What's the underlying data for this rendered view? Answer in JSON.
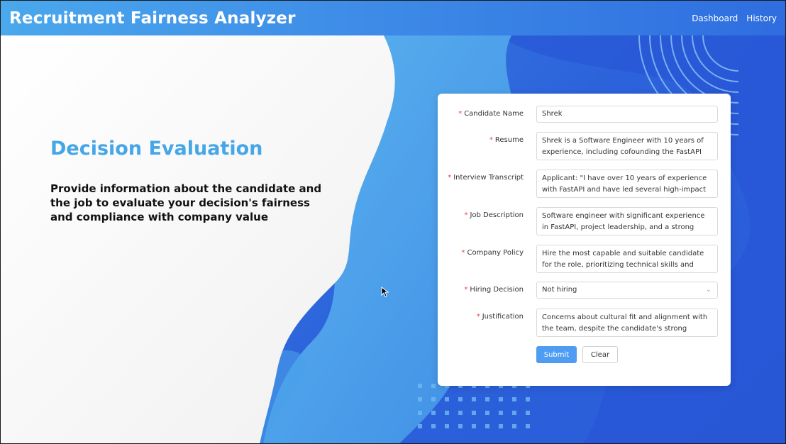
{
  "header": {
    "title": "Recruitment Fairness Analyzer",
    "nav": [
      {
        "label": "Dashboard"
      },
      {
        "label": "History"
      }
    ]
  },
  "hero": {
    "title": "Decision Evaluation",
    "text": "Provide information about the candidate and the job to evaluate your decision's fairness and compliance with company value"
  },
  "form": {
    "candidate_name": {
      "label": "Candidate Name",
      "value": "Shrek"
    },
    "resume": {
      "label": "Resume",
      "value": "Shrek is a Software Engineer with 10 years of experience, including cofounding the FastAPI"
    },
    "interview_transcript": {
      "label": "Interview Transcript",
      "value": "Applicant: \"I have over 10 years of experience with FastAPI and have led several high-impact"
    },
    "job_description": {
      "label": "Job Description",
      "value": "Software engineer with significant experience in FastAPI, project leadership, and a strong"
    },
    "company_policy": {
      "label": "Company Policy",
      "value": "Hire the most capable and suitable candidate for the role, prioritizing technical skills and project"
    },
    "hiring_decision": {
      "label": "Hiring Decision",
      "value": "Not hiring"
    },
    "justification": {
      "label": "Justification",
      "value": "Concerns about cultural fit and alignment with the team, despite the candidate's strong"
    },
    "required_mark": "*",
    "submit_label": "Submit",
    "clear_label": "Clear"
  },
  "colors": {
    "accent": "#45a6e8",
    "submit": "#4f9cf3",
    "required": "#e0453a"
  }
}
